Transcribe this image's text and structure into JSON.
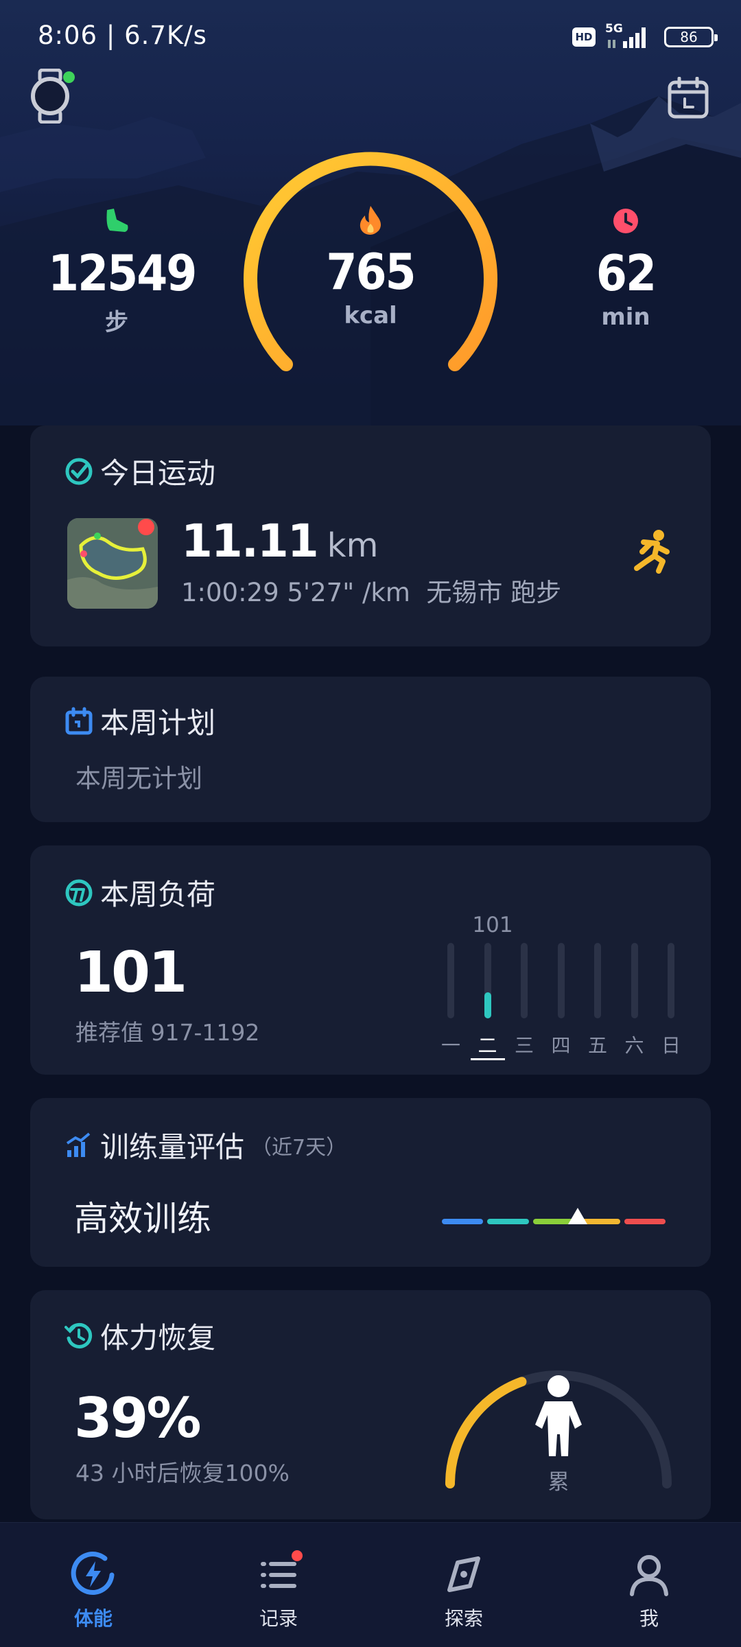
{
  "status_bar": {
    "time": "8:06 | 6.7K/s",
    "hd": "HD",
    "network": "5G",
    "battery": "86"
  },
  "header": {
    "watch_icon": "smartwatch-icon",
    "calendar_icon": "calendar-icon"
  },
  "summary": {
    "steps": {
      "value": "12549",
      "unit": "步",
      "icon": "footstep-icon",
      "color": "#2fcf6b"
    },
    "calories": {
      "value": "765",
      "unit": "kcal",
      "icon": "flame-icon",
      "color": "#ff8a2a"
    },
    "minutes": {
      "value": "62",
      "unit": "min",
      "icon": "clock-icon",
      "color": "#ff4f6b"
    },
    "ring_color_start": "#ffcc33",
    "ring_color_end": "#ff9a2a"
  },
  "today_exercise": {
    "title": "今日运动",
    "distance": "11.11",
    "distance_unit": "km",
    "details": "1:00:29 5'27\" /km  无锡市 跑步",
    "activity_icon": "running-icon"
  },
  "weekly_plan": {
    "title": "本周计划",
    "text": "本周无计划"
  },
  "weekly_load": {
    "title": "本周负荷",
    "value": "101",
    "recommended": "推荐值 917-1192",
    "bar_peak_label": "101",
    "days": [
      "一",
      "二",
      "三",
      "四",
      "五",
      "六",
      "日"
    ],
    "levels": [
      0,
      0.35,
      0,
      0,
      0,
      0,
      0
    ],
    "active_day_index": 1
  },
  "training_assessment": {
    "title": "训练量评估",
    "subtitle": "（近7天）",
    "status": "高效训练",
    "scale_colors": [
      "#3d8bf2",
      "#2ec7c0",
      "#8bcf3a",
      "#f2b731",
      "#ee4e4e"
    ],
    "marker_fraction": 0.6
  },
  "recovery": {
    "title": "体力恢复",
    "value": "39%",
    "detail": "43 小时后恢复100%",
    "state": "累",
    "level": 0.39
  },
  "nav": [
    {
      "label": "体能",
      "icon": "energy-icon",
      "active": true
    },
    {
      "label": "记录",
      "icon": "list-icon",
      "active": false,
      "badge": true
    },
    {
      "label": "探索",
      "icon": "compass-icon",
      "active": false
    },
    {
      "label": "我",
      "icon": "profile-icon",
      "active": false
    }
  ]
}
